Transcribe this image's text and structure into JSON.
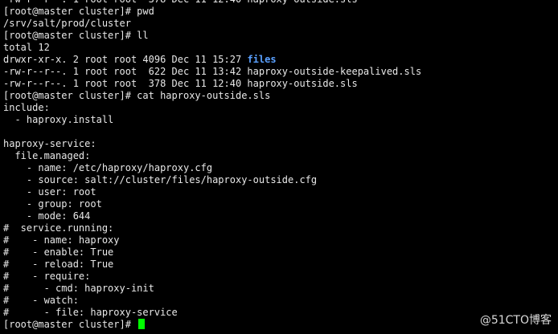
{
  "terminal": {
    "lines": [
      {
        "text": "-rw-r--r--. 1 root root  378 Dec 11 12:40 haproxy-outside.sls"
      },
      {
        "text": "[root@master cluster]# pwd"
      },
      {
        "text": "/srv/salt/prod/cluster"
      },
      {
        "text": "[root@master cluster]# ll"
      },
      {
        "text": "total 12"
      },
      {
        "text": "drwxr-xr-x. 2 root root 4096 Dec 11 15:27 ",
        "highlight": "files"
      },
      {
        "text": "-rw-r--r--. 1 root root  622 Dec 11 13:42 haproxy-outside-keepalived.sls"
      },
      {
        "text": "-rw-r--r--. 1 root root  378 Dec 11 12:40 haproxy-outside.sls"
      },
      {
        "text": "[root@master cluster]# cat haproxy-outside.sls"
      },
      {
        "text": "include:"
      },
      {
        "text": "  - haproxy.install"
      },
      {
        "text": ""
      },
      {
        "text": "haproxy-service:"
      },
      {
        "text": "  file.managed:"
      },
      {
        "text": "    - name: /etc/haproxy/haproxy.cfg"
      },
      {
        "text": "    - source: salt://cluster/files/haproxy-outside.cfg"
      },
      {
        "text": "    - user: root"
      },
      {
        "text": "    - group: root"
      },
      {
        "text": "    - mode: 644"
      },
      {
        "text": "#  service.running:"
      },
      {
        "text": "#    - name: haproxy"
      },
      {
        "text": "#    - enable: True"
      },
      {
        "text": "#    - reload: True"
      },
      {
        "text": "#    - require:"
      },
      {
        "text": "#      - cmd: haproxy-init"
      },
      {
        "text": "#    - watch:"
      },
      {
        "text": "#      - file: haproxy-service"
      },
      {
        "text": "[root@master cluster]# ",
        "cursor": true
      }
    ],
    "directory_color": "#5aa0ff",
    "cursor_color": "#00ff00"
  },
  "watermark": "@51CTO博客"
}
